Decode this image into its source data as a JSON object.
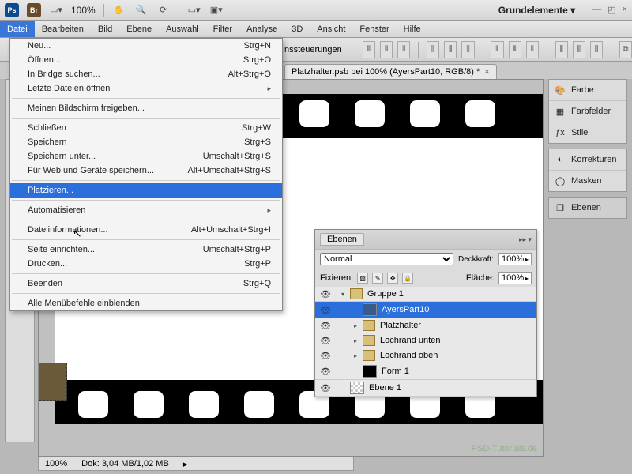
{
  "toolbar": {
    "zoom": "100%",
    "workspace": "Grundelemente ▾"
  },
  "menu": [
    "Datei",
    "Bearbeiten",
    "Bild",
    "Ebene",
    "Auswahl",
    "Filter",
    "Analyse",
    "3D",
    "Ansicht",
    "Fenster",
    "Hilfe"
  ],
  "optbar_label": "nssteuerungen",
  "doc_tab": {
    "title": "Platzhalter.psb bei 100% (AyersPart10, RGB/8) *",
    "close": "×"
  },
  "dropdown": {
    "groups": [
      [
        {
          "label": "Neu...",
          "short": "Strg+N"
        },
        {
          "label": "Öffnen...",
          "short": "Strg+O"
        },
        {
          "label": "In Bridge suchen...",
          "short": "Alt+Strg+O"
        },
        {
          "label": "Letzte Dateien öffnen",
          "short": "",
          "arrow": true
        }
      ],
      [
        {
          "label": "Meinen Bildschirm freigeben...",
          "short": ""
        }
      ],
      [
        {
          "label": "Schließen",
          "short": "Strg+W"
        },
        {
          "label": "Speichern",
          "short": "Strg+S"
        },
        {
          "label": "Speichern unter...",
          "short": "Umschalt+Strg+S"
        },
        {
          "label": "Für Web und Geräte speichern...",
          "short": "Alt+Umschalt+Strg+S"
        }
      ],
      [
        {
          "label": "Platzieren...",
          "short": "",
          "hover": true
        }
      ],
      [
        {
          "label": "Automatisieren",
          "short": "",
          "arrow": true
        }
      ],
      [
        {
          "label": "Dateiinformationen...",
          "short": "Alt+Umschalt+Strg+I"
        }
      ],
      [
        {
          "label": "Seite einrichten...",
          "short": "Umschalt+Strg+P"
        },
        {
          "label": "Drucken...",
          "short": "Strg+P"
        }
      ],
      [
        {
          "label": "Beenden",
          "short": "Strg+Q"
        }
      ],
      [
        {
          "label": "Alle Menübefehle einblenden",
          "short": ""
        }
      ]
    ]
  },
  "rpanels": {
    "group1": [
      {
        "icon": "🎨",
        "label": "Farbe"
      },
      {
        "icon": "▦",
        "label": "Farbfelder"
      },
      {
        "icon": "ƒx",
        "label": "Stile"
      }
    ],
    "group2": [
      {
        "icon": "◐",
        "label": "Korrekturen"
      },
      {
        "icon": "◯",
        "label": "Masken"
      }
    ],
    "group3": [
      {
        "icon": "❐",
        "label": "Ebenen",
        "active": true
      }
    ]
  },
  "layers": {
    "tab": "Ebenen",
    "blend": "Normal",
    "opacity_label": "Deckkraft:",
    "opacity": "100%",
    "lock_label": "Fixieren:",
    "fill_label": "Fläche:",
    "fill": "100%",
    "items": [
      {
        "indent": 0,
        "type": "group",
        "name": "Gruppe 1",
        "expanded": true
      },
      {
        "indent": 1,
        "type": "smart",
        "name": "AyersPart10",
        "selected": true
      },
      {
        "indent": 1,
        "type": "group",
        "name": "Platzhalter"
      },
      {
        "indent": 1,
        "type": "group",
        "name": "Lochrand unten"
      },
      {
        "indent": 1,
        "type": "group",
        "name": "Lochrand oben"
      },
      {
        "indent": 1,
        "type": "shape",
        "name": "Form 1"
      },
      {
        "indent": 0,
        "type": "layer",
        "name": "Ebene 1",
        "checker": true
      }
    ]
  },
  "status": {
    "zoom": "100%",
    "doc": "Dok: 3,04 MB/1,02 MB"
  },
  "watermark": "PSD-Tutorials.de"
}
